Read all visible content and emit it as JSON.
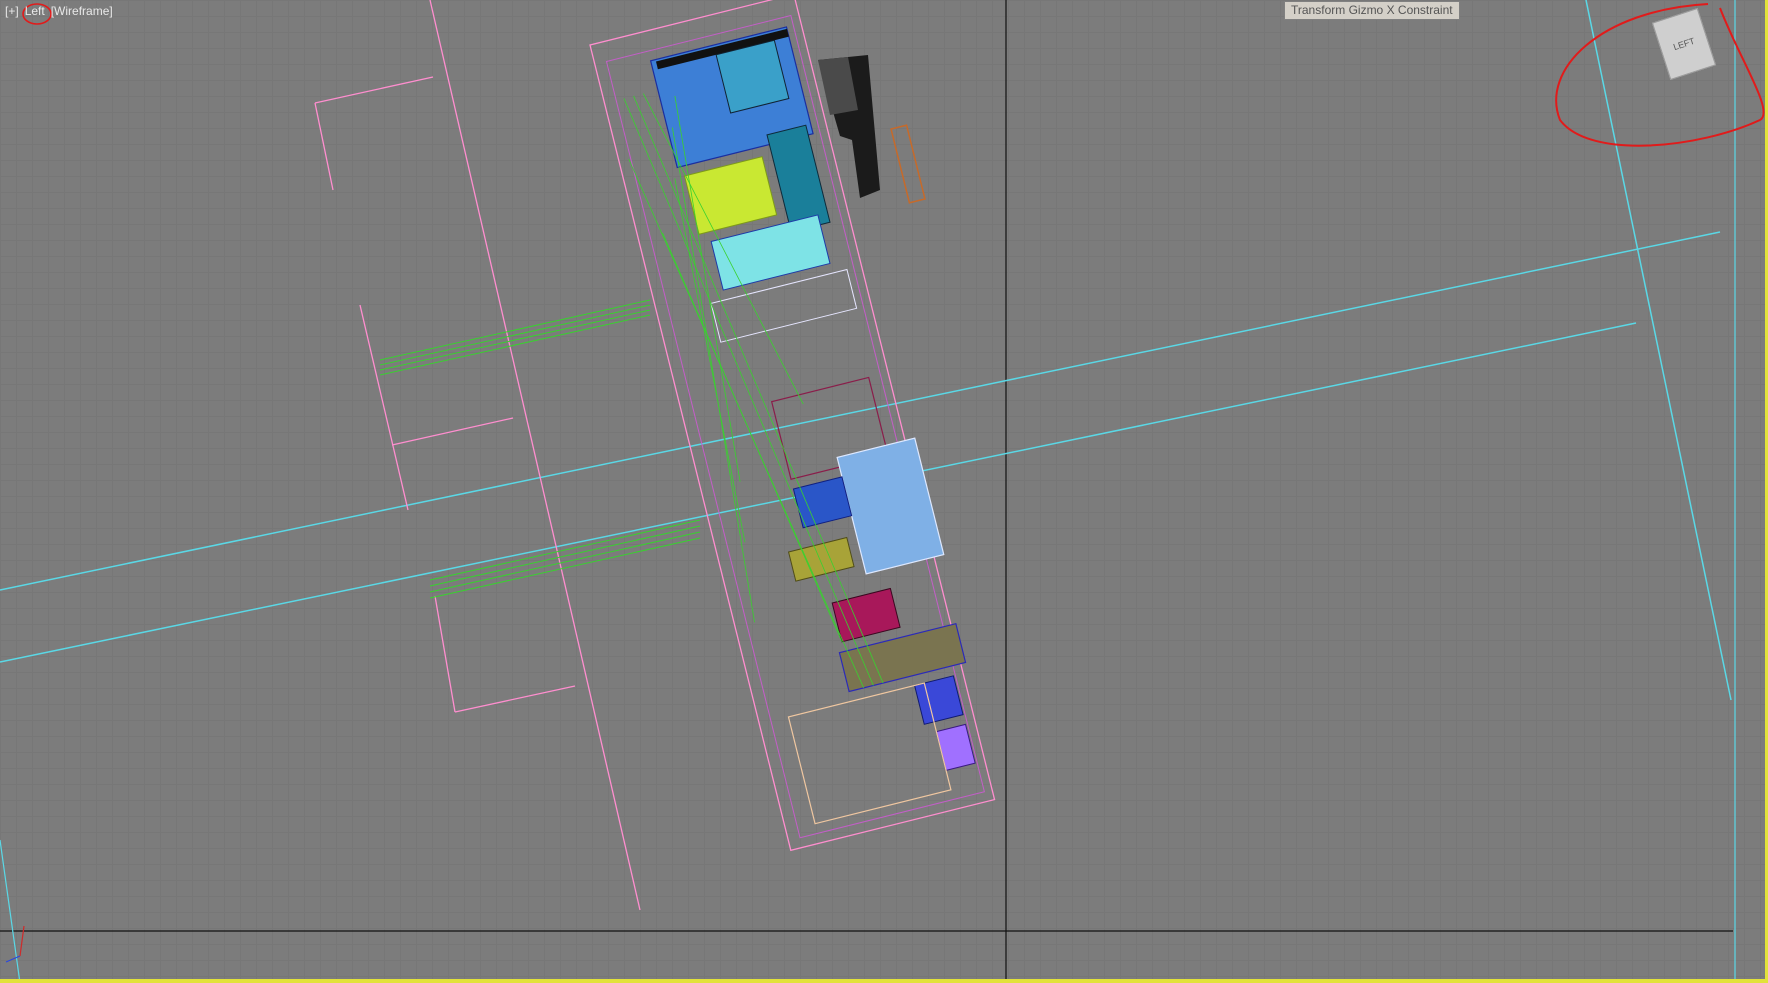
{
  "viewport": {
    "menu_label": "[+]",
    "view_label": "Left",
    "shading_label": "[Wireframe]"
  },
  "tooltip": {
    "text": "Transform Gizmo X Constraint"
  },
  "viewcube": {
    "face_label": "LEFT"
  },
  "colors": {
    "viewport_bg": "#7c7c7c",
    "active_border": "#e2e23a",
    "annotation_red": "#e11b1b",
    "helper_cyan": "#5ad8e6",
    "wire_green": "#39d12f",
    "wire_pink": "#ff8ecf"
  },
  "icons": {
    "world_axis": "axis-tripod-icon",
    "viewcube": "viewcube-icon"
  }
}
